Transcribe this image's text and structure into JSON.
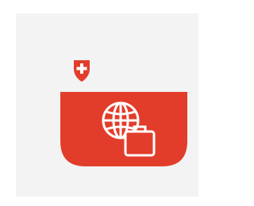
{
  "app_icon": {
    "icons": [
      "swiss-cross-shield-icon",
      "globe-icon",
      "briefcase-icon"
    ],
    "colors": {
      "background": "#f3f3f3",
      "accent_red": "#e23d2a",
      "white": "#ffffff"
    }
  }
}
